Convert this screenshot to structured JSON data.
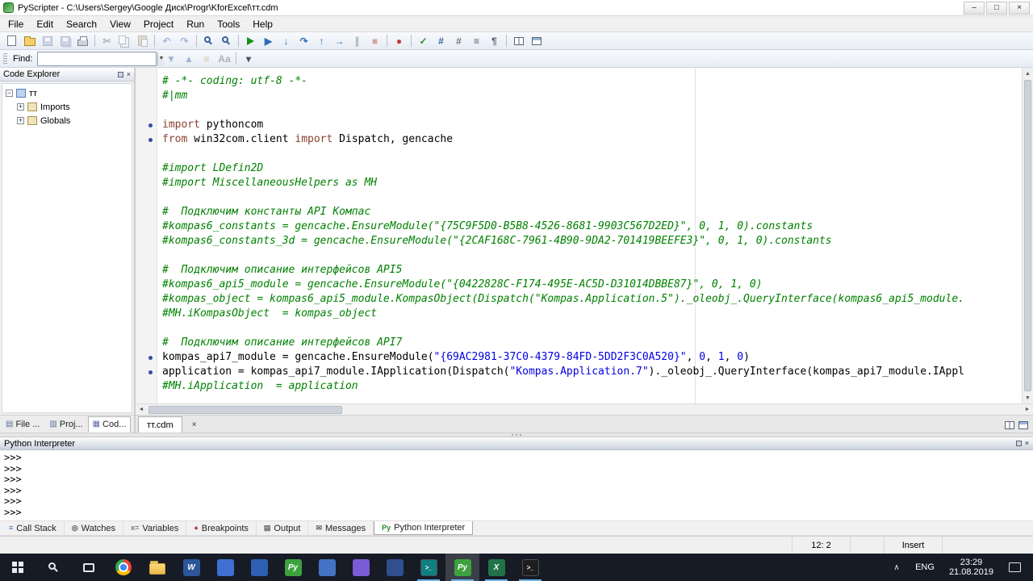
{
  "colors": {
    "comment": "#008000",
    "keyword": "#8b3e2f",
    "string": "#0000e0",
    "number": "#0000e0",
    "plain": "#000000",
    "accent_run": "#149414"
  },
  "glyphs": {
    "min": "–",
    "max": "□",
    "close": "×",
    "combo": "▼",
    "scroll_up": "▲",
    "scroll_down": "▼",
    "scroll_left": "◄",
    "scroll_right": "►",
    "tray_chevron": "∧"
  },
  "window": {
    "title": "PyScripter - C:\\Users\\Sergey\\Google Диск\\Progr\\KforExcel\\тт.cdm"
  },
  "menu": [
    "File",
    "Edit",
    "Search",
    "View",
    "Project",
    "Run",
    "Tools",
    "Help"
  ],
  "toolbar_main": [
    {
      "name": "new-file",
      "type": "page"
    },
    {
      "name": "open-file",
      "type": "folder"
    },
    {
      "name": "save-file",
      "type": "disk",
      "dim": true
    },
    {
      "name": "save-all",
      "type": "disk2",
      "dim": true
    },
    {
      "name": "print",
      "type": "printer"
    },
    {
      "type": "sep"
    },
    {
      "name": "cut",
      "type": "glyph",
      "g": "✂",
      "c": "#4a5568",
      "dim": true
    },
    {
      "name": "copy",
      "type": "copy",
      "dim": true
    },
    {
      "name": "paste",
      "type": "paste",
      "dim": true
    },
    {
      "type": "sep"
    },
    {
      "name": "undo",
      "type": "glyph",
      "g": "↶",
      "c": "#2f6db5",
      "dim": true
    },
    {
      "name": "redo",
      "type": "glyph",
      "g": "↷",
      "c": "#2f6db5",
      "dim": true
    },
    {
      "type": "sep"
    },
    {
      "name": "find",
      "type": "lens"
    },
    {
      "name": "find-in-files",
      "type": "lens"
    },
    {
      "type": "sep"
    },
    {
      "name": "run",
      "type": "play"
    },
    {
      "name": "debug",
      "type": "glyph",
      "g": "▶",
      "c": "#2f6db5"
    },
    {
      "name": "step-into",
      "type": "glyph",
      "g": "↓",
      "c": "#2f6db5"
    },
    {
      "name": "step-over",
      "type": "glyph",
      "g": "↷",
      "c": "#2f6db5"
    },
    {
      "name": "step-out",
      "type": "glyph",
      "g": "↑",
      "c": "#2f6db5"
    },
    {
      "name": "run-to-cursor",
      "type": "glyph",
      "g": "→",
      "c": "#2f6db5"
    },
    {
      "name": "pause",
      "type": "glyph",
      "g": "∥",
      "c": "#3b7a3b",
      "dim": true
    },
    {
      "name": "stop",
      "type": "glyph",
      "g": "■",
      "c": "#b03a3a",
      "dim": true
    },
    {
      "type": "sep"
    },
    {
      "name": "toggle-breakpoint",
      "type": "glyph",
      "g": "●",
      "c": "#c03b3b"
    },
    {
      "type": "sep"
    },
    {
      "name": "syntax-check",
      "type": "glyph",
      "g": "✓",
      "c": "#2e8b2e"
    },
    {
      "name": "bookmarks",
      "type": "glyph",
      "g": "#",
      "c": "#3a66b0"
    },
    {
      "name": "goto-line",
      "type": "glyph",
      "g": "#",
      "c": "#777777"
    },
    {
      "name": "line-numbers",
      "type": "glyph",
      "g": "≡",
      "c": "#556070"
    },
    {
      "name": "special-chars",
      "type": "glyph",
      "g": "¶",
      "c": "#556070"
    },
    {
      "type": "sep"
    },
    {
      "name": "split-editor",
      "type": "winsplit"
    },
    {
      "name": "editor-options",
      "type": "win"
    }
  ],
  "find_bar": {
    "label": "Find:",
    "value": "",
    "actions": [
      {
        "name": "find-next",
        "type": "glyph",
        "g": "▼",
        "c": "#3a5f9e",
        "dim": true
      },
      {
        "name": "find-prev",
        "type": "glyph",
        "g": "▲",
        "c": "#3a5f9e",
        "dim": true
      },
      {
        "name": "highlight-all",
        "type": "glyph",
        "g": "≡",
        "c": "#b58a2e",
        "dim": true
      },
      {
        "name": "match-case",
        "type": "glyph",
        "g": "Aa",
        "c": "#555555",
        "dim": true
      },
      {
        "type": "sep"
      },
      {
        "name": "search-options",
        "type": "glyph",
        "g": "▾",
        "c": "#445566"
      }
    ]
  },
  "code_explorer": {
    "title": "Code Explorer",
    "nodes": [
      {
        "label": "тт",
        "exp": "open",
        "level": 0,
        "bg": "#bcd2ef",
        "bd": "#5b7db1"
      },
      {
        "label": "Imports",
        "exp": "closed",
        "level": 1,
        "bg": "#efe3bc",
        "bd": "#a8924e"
      },
      {
        "label": "Globals",
        "exp": "closed",
        "level": 1,
        "bg": "#efe3bc",
        "bd": "#a8924e"
      }
    ]
  },
  "left_tabs": [
    {
      "label": "File ...",
      "g": "▤",
      "active": false
    },
    {
      "label": "Proj...",
      "g": "▥",
      "active": false
    },
    {
      "label": "Cod...",
      "g": "▦",
      "active": true
    }
  ],
  "editor": {
    "tab": "тт.cdm",
    "lines": [
      {
        "t": [
          [
            "c",
            "# -*- coding: utf-8 -*-"
          ]
        ]
      },
      {
        "t": [
          [
            "c",
            "#|mm"
          ]
        ]
      },
      {
        "t": []
      },
      {
        "d": 1,
        "t": [
          [
            "k",
            "import"
          ],
          [
            "p",
            " pythoncom"
          ]
        ]
      },
      {
        "d": 1,
        "t": [
          [
            "k",
            "from"
          ],
          [
            "p",
            " win32com.client "
          ],
          [
            "k",
            "import"
          ],
          [
            "p",
            " Dispatch, gencache"
          ]
        ]
      },
      {
        "t": []
      },
      {
        "t": [
          [
            "c",
            "#import LDefin2D"
          ]
        ]
      },
      {
        "t": [
          [
            "c",
            "#import MiscellaneousHelpers as MH"
          ]
        ]
      },
      {
        "t": []
      },
      {
        "t": [
          [
            "c",
            "#  Подключим константы API Компас"
          ]
        ]
      },
      {
        "t": [
          [
            "c",
            "#kompas6_constants = gencache.EnsureModule(\"{75C9F5D0-B5B8-4526-8681-9903C567D2ED}\", 0, 1, 0).constants"
          ]
        ]
      },
      {
        "t": [
          [
            "c",
            "#kompas6_constants_3d = gencache.EnsureModule(\"{2CAF168C-7961-4B90-9DA2-701419BEEFE3}\", 0, 1, 0).constants"
          ]
        ]
      },
      {
        "t": []
      },
      {
        "t": [
          [
            "c",
            "#  Подключим описание интерфейсов API5"
          ]
        ]
      },
      {
        "t": [
          [
            "c",
            "#kompas6_api5_module = gencache.EnsureModule(\"{0422828C-F174-495E-AC5D-D31014DBBE87}\", 0, 1, 0)"
          ]
        ]
      },
      {
        "t": [
          [
            "c",
            "#kompas_object = kompas6_api5_module.KompasObject(Dispatch(\"Kompas.Application.5\")._oleobj_.QueryInterface(kompas6_api5_module."
          ]
        ]
      },
      {
        "t": [
          [
            "c",
            "#MH.iKompasObject  = kompas_object"
          ]
        ]
      },
      {
        "t": []
      },
      {
        "t": [
          [
            "c",
            "#  Подключим описание интерфейсов API7"
          ]
        ]
      },
      {
        "d": 1,
        "t": [
          [
            "p",
            "kompas_api7_module = gencache.EnsureModule("
          ],
          [
            "s",
            "\"{69AC2981-37C0-4379-84FD-5DD2F3C0A520}\""
          ],
          [
            "p",
            ", "
          ],
          [
            "n",
            "0"
          ],
          [
            "p",
            ", "
          ],
          [
            "n",
            "1"
          ],
          [
            "p",
            ", "
          ],
          [
            "n",
            "0"
          ],
          [
            "p",
            ")"
          ]
        ]
      },
      {
        "d": 1,
        "t": [
          [
            "p",
            "application = kompas_api7_module.IApplication(Dispatch("
          ],
          [
            "s",
            "\"Kompas.Application.7\""
          ],
          [
            "p",
            ")._oleobj_.QueryInterface(kompas_api7_module.IAppl"
          ]
        ]
      },
      {
        "t": [
          [
            "c",
            "#MH.iApplication  = application"
          ]
        ]
      }
    ]
  },
  "interpreter": {
    "title": "Python Interpreter",
    "lines": [
      ">>>",
      ">>>",
      ">>>",
      ">>>",
      ">>>",
      ">>>"
    ]
  },
  "dock_tabs": [
    {
      "label": "Call Stack",
      "g": "≡",
      "c": "#3b6fc4"
    },
    {
      "label": "Watches",
      "g": "◎",
      "c": "#555555"
    },
    {
      "label": "Variables",
      "g": "x=",
      "c": "#777777"
    },
    {
      "label": "Breakpoints",
      "g": "●",
      "c": "#c03b3b"
    },
    {
      "label": "Output",
      "g": "▤",
      "c": "#666666"
    },
    {
      "label": "Messages",
      "g": "✉",
      "c": "#666666"
    },
    {
      "label": "Python Interpreter",
      "g": "Py",
      "c": "#2e8b2e",
      "active": true
    }
  ],
  "status": {
    "cursor": "12: 2",
    "mode": "Insert"
  },
  "taskbar": {
    "lang": "ENG",
    "time": "23:29",
    "date": "21.08.2019",
    "apps": [
      {
        "name": "chrome",
        "type": "chrome"
      },
      {
        "name": "file-explorer",
        "type": "folder"
      },
      {
        "name": "word",
        "type": "letter",
        "bg": "#2b579a",
        "label": "W"
      },
      {
        "name": "app-blue-1",
        "type": "letter",
        "bg": "#3f6fd1",
        "label": ""
      },
      {
        "name": "app-blue-2",
        "type": "letter",
        "bg": "#2f5fb3",
        "label": ""
      },
      {
        "name": "pyscripter-1",
        "type": "letter",
        "bg": "#3da23d",
        "label": "Py"
      },
      {
        "name": "app-blue-3",
        "type": "letter",
        "bg": "#4472c4",
        "label": ""
      },
      {
        "name": "app-purple",
        "type": "letter",
        "bg": "#7b5cd6",
        "label": ""
      },
      {
        "name": "app-blue-4",
        "type": "letter",
        "bg": "#2f4f8f",
        "label": ""
      },
      {
        "name": "console-teal",
        "type": "console",
        "bg": "#0f7f7f",
        "running": true
      },
      {
        "name": "pyscripter-active",
        "type": "letter",
        "bg": "#3da23d",
        "label": "Py",
        "running": true,
        "active": true
      },
      {
        "name": "excel",
        "type": "letter",
        "bg": "#217346",
        "label": "X",
        "running": true
      },
      {
        "name": "console-dark",
        "type": "console",
        "bg": "#1e1e1e",
        "running": true
      }
    ]
  }
}
